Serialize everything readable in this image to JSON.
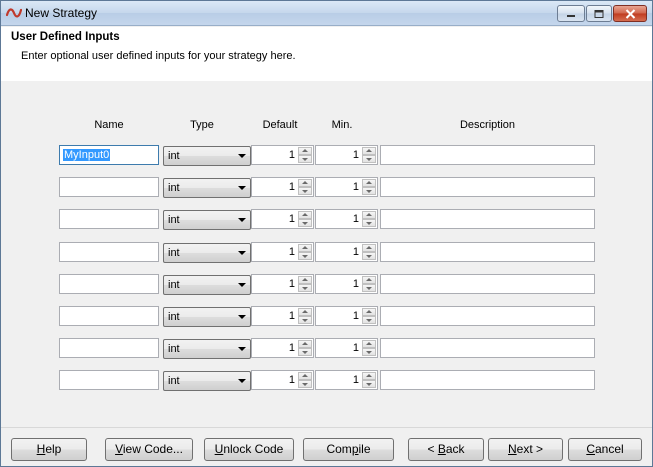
{
  "window": {
    "title": "New Strategy"
  },
  "header": {
    "title": "User Defined Inputs",
    "subtitle": "Enter optional user defined inputs for your strategy here."
  },
  "columns": {
    "name": "Name",
    "type": "Type",
    "default": "Default",
    "min": "Min.",
    "description": "Description"
  },
  "rows": [
    {
      "name": "MyInput0",
      "type": "int",
      "default": "1",
      "min": "1",
      "description": ""
    },
    {
      "name": "",
      "type": "int",
      "default": "1",
      "min": "1",
      "description": ""
    },
    {
      "name": "",
      "type": "int",
      "default": "1",
      "min": "1",
      "description": ""
    },
    {
      "name": "",
      "type": "int",
      "default": "1",
      "min": "1",
      "description": ""
    },
    {
      "name": "",
      "type": "int",
      "default": "1",
      "min": "1",
      "description": ""
    },
    {
      "name": "",
      "type": "int",
      "default": "1",
      "min": "1",
      "description": ""
    },
    {
      "name": "",
      "type": "int",
      "default": "1",
      "min": "1",
      "description": ""
    },
    {
      "name": "",
      "type": "int",
      "default": "1",
      "min": "1",
      "description": ""
    }
  ],
  "buttons": {
    "help": {
      "mnemonic": "H",
      "rest": "elp"
    },
    "view_code": {
      "mnemonic": "V",
      "rest": "iew Code..."
    },
    "unlock_code": {
      "mnemonic": "U",
      "rest": "nlock Code"
    },
    "compile": {
      "pre": "Com",
      "mnemonic": "p",
      "rest": "ile"
    },
    "back": {
      "pre": "< ",
      "mnemonic": "B",
      "rest": "ack"
    },
    "next": {
      "pre": "",
      "mnemonic": "N",
      "rest": "ext >"
    },
    "cancel": {
      "mnemonic": "C",
      "rest": "ancel"
    }
  },
  "icons": {
    "app": "strategy-wave-icon",
    "minimize": "minimize-icon",
    "maximize": "maximize-icon",
    "close": "close-icon"
  }
}
